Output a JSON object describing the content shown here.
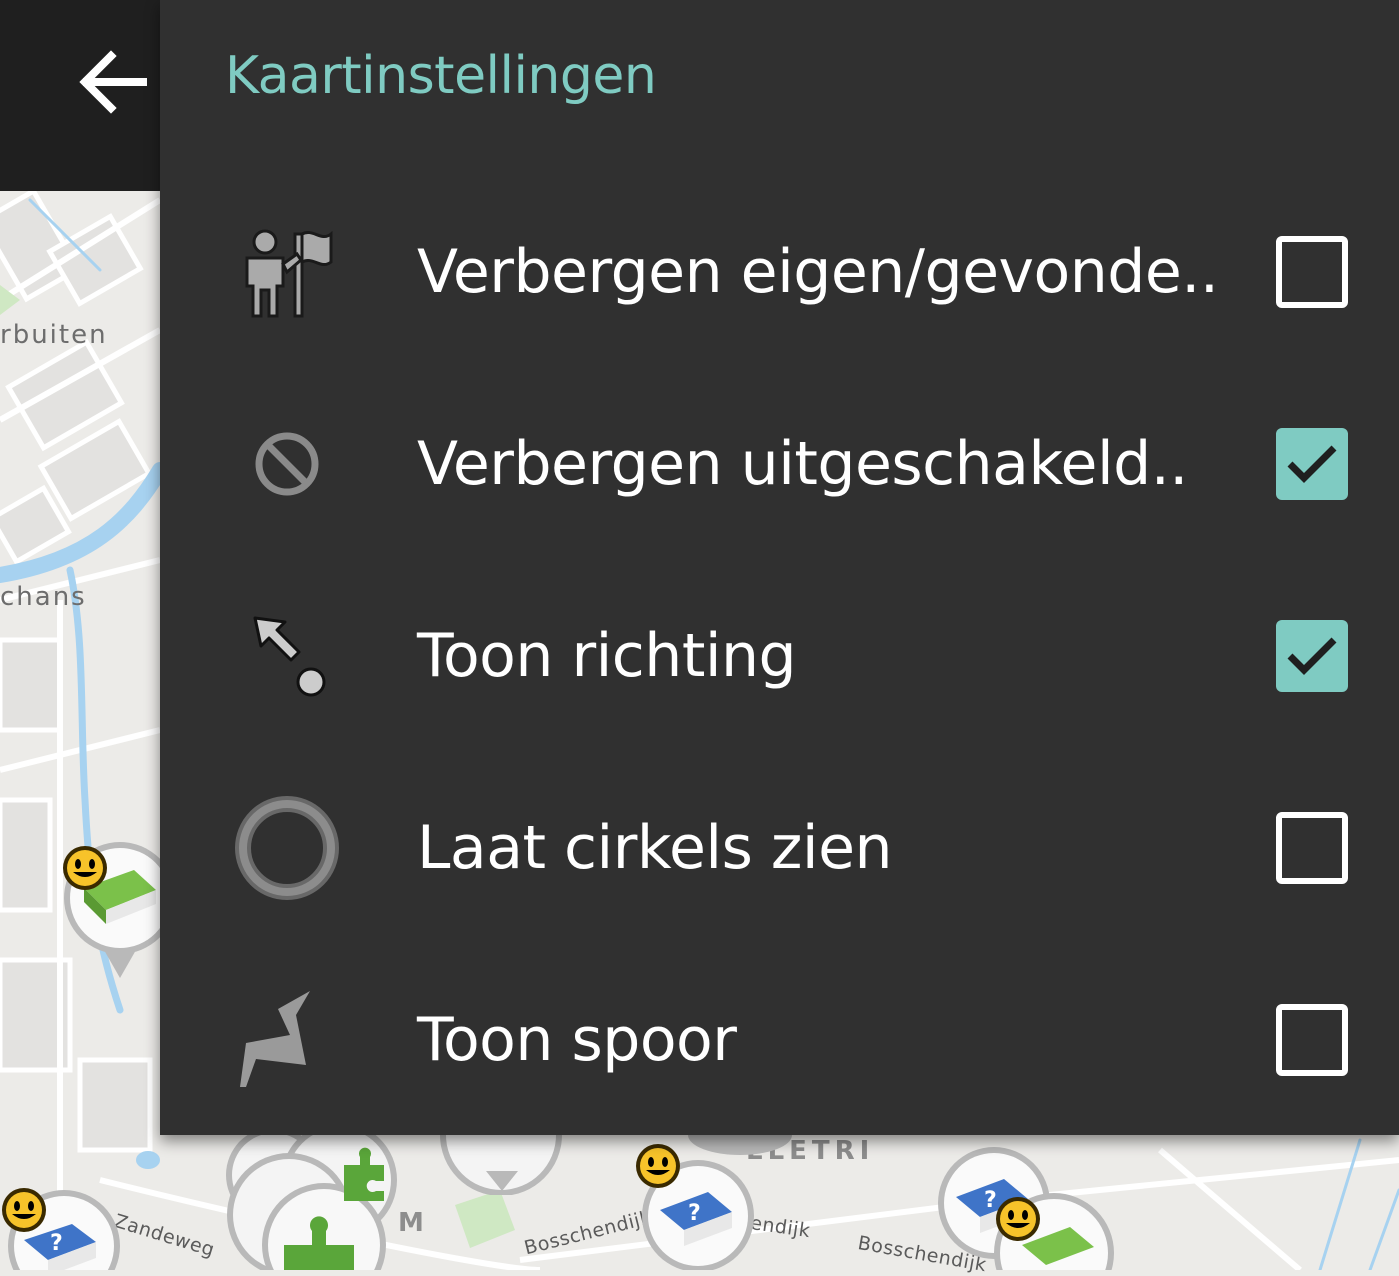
{
  "header": {
    "title": "Kaartinstellingen",
    "back_icon": "arrow-left-icon"
  },
  "colors": {
    "accent": "#7fcbc2",
    "panel_background": "#303030",
    "toolbar_background": "#1f1f1f",
    "label_text": "#ffffff"
  },
  "settings": [
    {
      "label": "Verbergen eigen/gevonde..",
      "icon": "person-flag-icon",
      "checked": false
    },
    {
      "label": "Verbergen uitgeschakeld..",
      "icon": "prohibited-icon",
      "checked": true
    },
    {
      "label": "Toon richting",
      "icon": "direction-arrow-icon",
      "checked": true
    },
    {
      "label": "Laat cirkels zien",
      "icon": "circle-icon",
      "checked": false
    },
    {
      "label": "Toon spoor",
      "icon": "track-icon",
      "checked": false
    }
  ],
  "map": {
    "labels": {
      "west": "rbuiten",
      "chans": "chans",
      "celletri": "LLETRI",
      "m": "M",
      "zandeweg": "Zandeweg",
      "bosschendijk_1": "Bosschendijk",
      "bosschendijk_2": "endijk",
      "bosschendijk_3": "Bosschendijk"
    }
  }
}
